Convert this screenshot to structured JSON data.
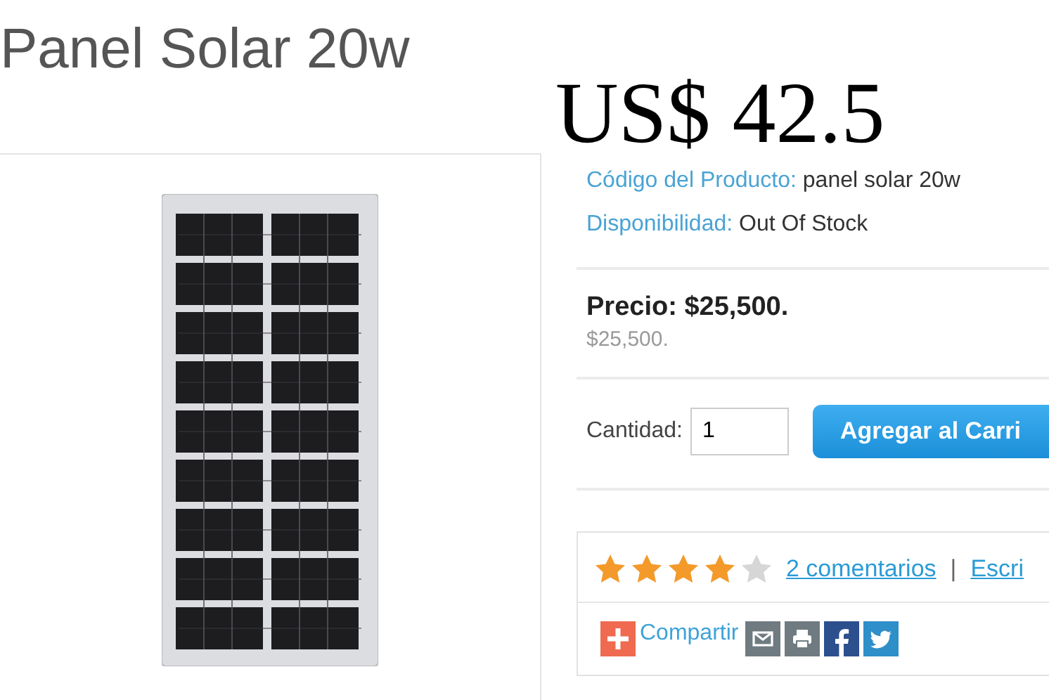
{
  "page_title": "Panel Solar 20w",
  "price_overlay": "US$ 42.5",
  "details": [
    {
      "label": "Código del Producto:",
      "value": "panel solar 20w"
    },
    {
      "label": "Disponibilidad:",
      "value": "Out Of Stock"
    }
  ],
  "price": {
    "current": "Precio: $25,500.",
    "old": "$25,500."
  },
  "quantity": {
    "label": "Cantidad:",
    "value": "1"
  },
  "add_button": "Agregar al Carri",
  "rating": {
    "stars": 4,
    "reviews_link": "2 comentarios",
    "separator": "|",
    "write_link": "Escri"
  },
  "share": {
    "label": "Compartir"
  }
}
